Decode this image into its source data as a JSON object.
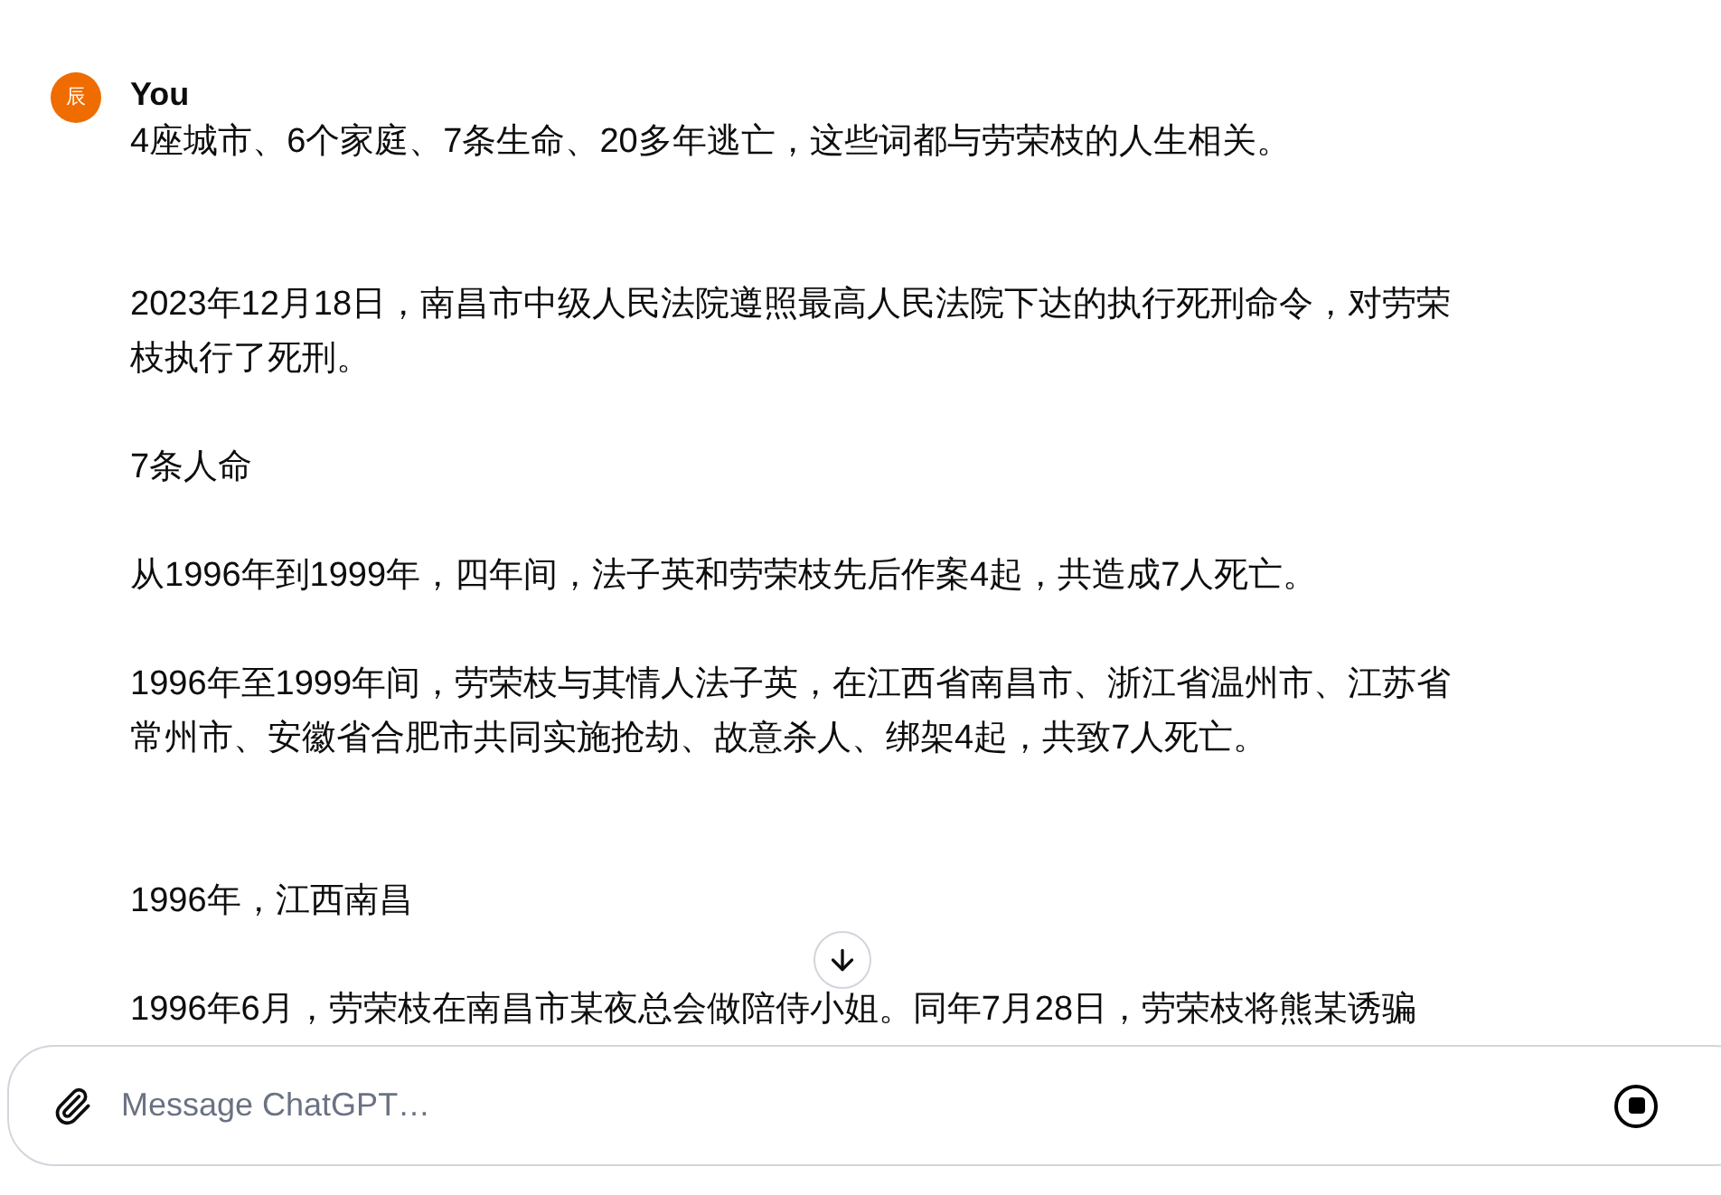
{
  "message": {
    "avatar": "辰",
    "author": "You",
    "paragraphs": [
      "4座城市、6个家庭、7条生命、20多年逃亡，这些词都与劳荣枝的人生相关。",
      "\n2023年12月18日，南昌市中级人民法院遵照最高人民法院下达的执行死刑命令，对劳荣枝执行了死刑。",
      "7条人命",
      "从1996年到1999年，四年间，法子英和劳荣枝先后作案4起，共造成7人死亡。",
      "1996年至1999年间，劳荣枝与其情人法子英，在江西省南昌市、浙江省温州市、江苏省常州市、安徽省合肥市共同实施抢劫、故意杀人、绑架4起，共致7人死亡。",
      "\n1996年，江西南昌",
      "1996年6月，劳荣枝在南昌市某夜总会做陪侍小姐。同年7月28日，劳荣枝将熊某诱骗"
    ]
  },
  "composer": {
    "placeholder": "Message ChatGPT…",
    "generating": true
  }
}
